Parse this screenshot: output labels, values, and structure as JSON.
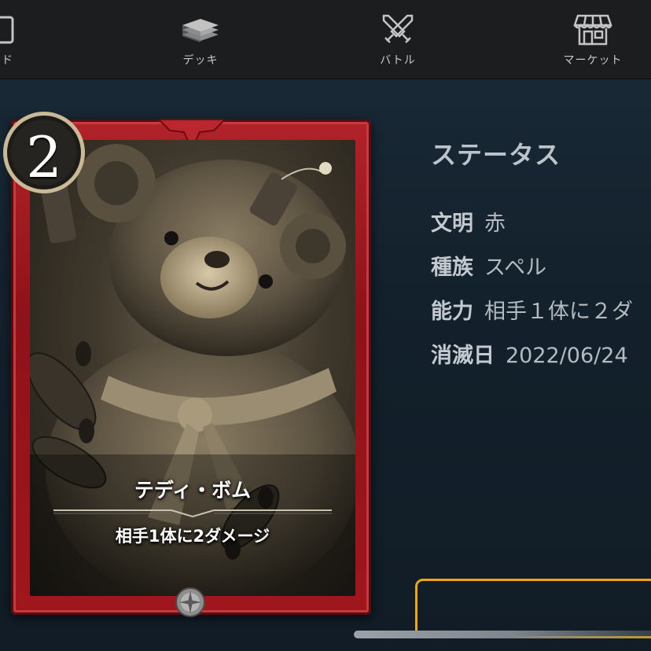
{
  "nav": {
    "items": [
      {
        "label": "ード",
        "icon": "card-icon"
      },
      {
        "label": "デッキ",
        "icon": "deck-icon"
      },
      {
        "label": "バトル",
        "icon": "crossed-swords-icon"
      },
      {
        "label": "マーケット",
        "icon": "shop-icon"
      }
    ]
  },
  "card": {
    "cost": "2",
    "name": "テディ・ボム",
    "text": "相手1体に2ダメージ",
    "frame_color": "#a3171e"
  },
  "status": {
    "title": "ステータス",
    "rows": [
      {
        "key": "文明",
        "value": "赤"
      },
      {
        "key": "種族",
        "value": "スペル"
      },
      {
        "key": "能力",
        "value": "相手１体に２ダ"
      },
      {
        "key": "消滅日",
        "value": "2022/06/24"
      }
    ]
  },
  "colors": {
    "accent": "#f0a70e",
    "nav_bg": "#1c1d1f",
    "page_bg": "#13202b"
  }
}
